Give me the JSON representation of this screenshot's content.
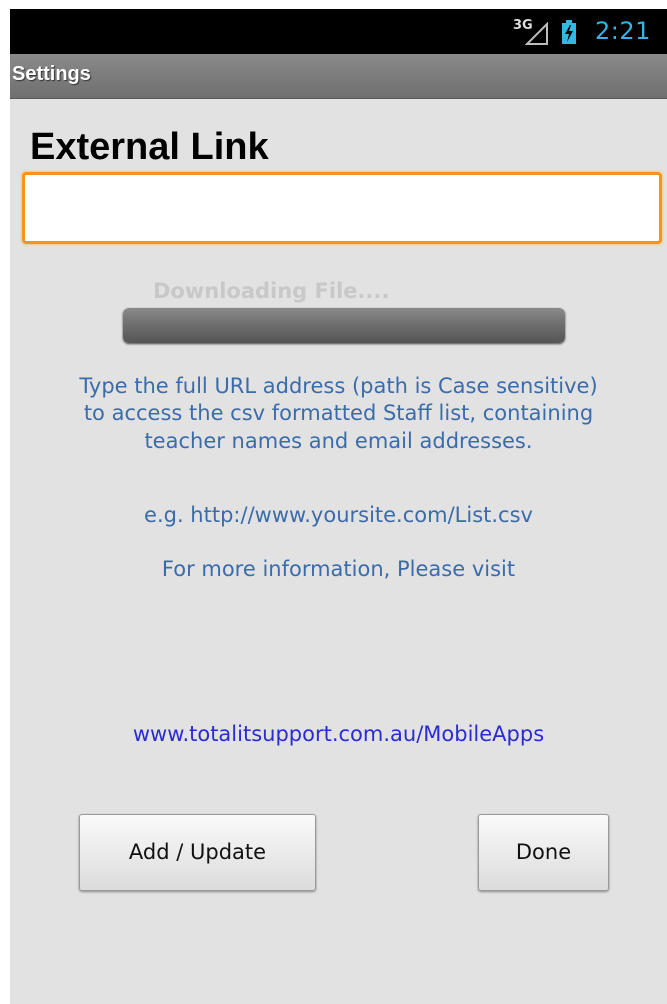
{
  "status_bar": {
    "network": "3G",
    "time": "2:21",
    "icons": [
      "signal-icon",
      "battery-charging-icon"
    ]
  },
  "title_bar": {
    "title": "Settings"
  },
  "main": {
    "heading": "External Link",
    "url_input": {
      "value": "",
      "placeholder": ""
    },
    "download": {
      "label": "Downloading File....",
      "progress": 0
    },
    "instructions": [
      "Type the full URL address (path is Case sensitive)",
      "to access the csv formatted Staff list, containing",
      "teacher names and email addresses."
    ],
    "example": "e.g.  http://www.yoursite.com/List.csv",
    "more_info": "For more information, Please visit",
    "link": "www.totalitsupport.com.au/MobileApps"
  },
  "buttons": {
    "add_update": "Add / Update",
    "done": "Done"
  },
  "colors": {
    "accent": "#33b5e5",
    "focus_border": "#f7941d",
    "info_text": "#3b6caa",
    "link": "#2b2bd6"
  }
}
